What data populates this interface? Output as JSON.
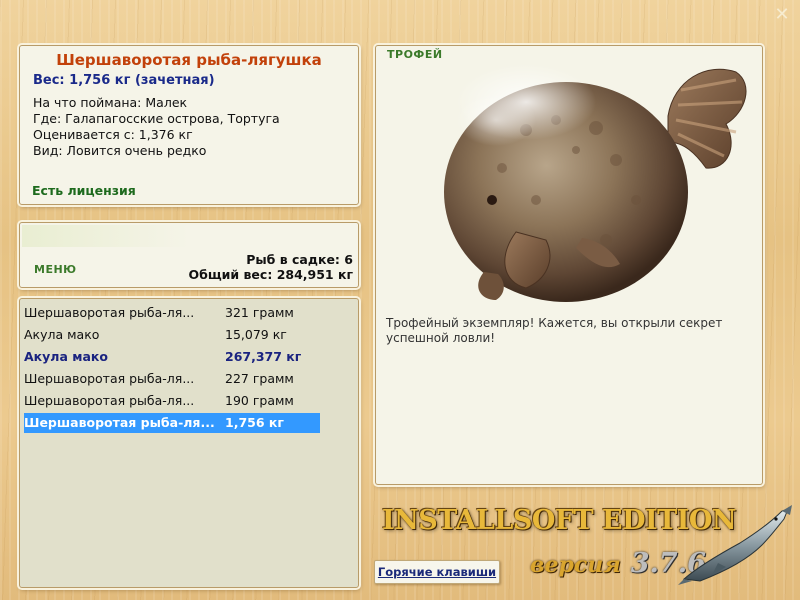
{
  "window": {
    "close_glyph": "✕"
  },
  "fish": {
    "title": "Шершаворотая рыба-лягушка",
    "weight_line": "Вес: 1,756 кг (зачетная)",
    "details": [
      {
        "label": "На что поймана:",
        "value": "Малек"
      },
      {
        "label": "Где:",
        "value": "Галапагосские острова, Тортуга"
      },
      {
        "label": "Оценивается с:",
        "value": "1,376 кг"
      },
      {
        "label": "Вид:",
        "value": "Ловится очень редко"
      }
    ],
    "license": "Есть лицензия"
  },
  "menu": {
    "label": "МЕНЮ",
    "fish_in_cage_label": "Рыб в садке:",
    "fish_in_cage_value": "6",
    "total_weight_label": "Общий вес:",
    "total_weight_value": "284,951 кг"
  },
  "catch_list": [
    {
      "name": "Шершаворотая рыба-ля...",
      "weight": "321 грамм",
      "style": "normal"
    },
    {
      "name": "Акула мако",
      "weight": "15,079 кг",
      "style": "normal"
    },
    {
      "name": "Акула мако",
      "weight": "267,377 кг",
      "style": "bold"
    },
    {
      "name": "Шершаворотая рыба-ля...",
      "weight": "227 грамм",
      "style": "normal"
    },
    {
      "name": "Шершаворотая рыба-ля...",
      "weight": "190 грамм",
      "style": "normal"
    },
    {
      "name": "Шершаворотая рыба-ля...",
      "weight": "1,756 кг",
      "style": "selected"
    }
  ],
  "trophy": {
    "label": "ТРОФЕЙ",
    "image_icon": "frogfish-icon",
    "message": "Трофейный экземпляр! Кажется, вы открыли секрет успешной ловли!"
  },
  "footer": {
    "hotkeys_label": "Горячие клавиши",
    "brand_text": "INSTALLSOFT EDITION",
    "version_word": "версия",
    "version_number": "3.7.6",
    "logo_icon": "sturgeon-icon"
  },
  "colors": {
    "title": "#c2410a",
    "weight": "#1a2a8a",
    "license": "#1d6a1d",
    "selection": "#3399ff",
    "panel": "#f5f4e8"
  }
}
